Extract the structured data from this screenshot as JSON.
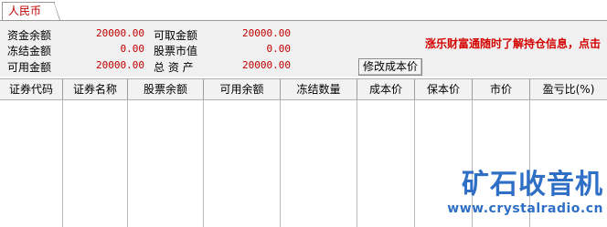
{
  "tab": {
    "label": "人民币"
  },
  "summary": {
    "funds_balance_label": "资金余额",
    "funds_balance_value": "20000.00",
    "withdrawable_label": "可取金额",
    "withdrawable_value": "20000.00",
    "frozen_label": "冻结金额",
    "frozen_value": "0.00",
    "stock_value_label": "股票市值",
    "stock_value_value": "0.00",
    "available_label": "可用金额",
    "available_value": "20000.00",
    "total_assets_label": "总 资 产",
    "total_assets_value": "20000.00"
  },
  "notice": "涨乐财富通随时了解持仓信息，点击",
  "modify_cost_button": "修改成本价",
  "table": {
    "columns": [
      "证券代码",
      "证券名称",
      "股票余额",
      "可用余额",
      "冻结数量",
      "成本价",
      "保本价",
      "市价",
      "盈亏比(%)"
    ]
  },
  "watermark": {
    "title": "矿石收音机",
    "url": "www.crystalradio.cn"
  },
  "colors": {
    "value_red": "#c00000",
    "notice_red": "#d40000",
    "watermark_blue": "#2f6fc6"
  }
}
